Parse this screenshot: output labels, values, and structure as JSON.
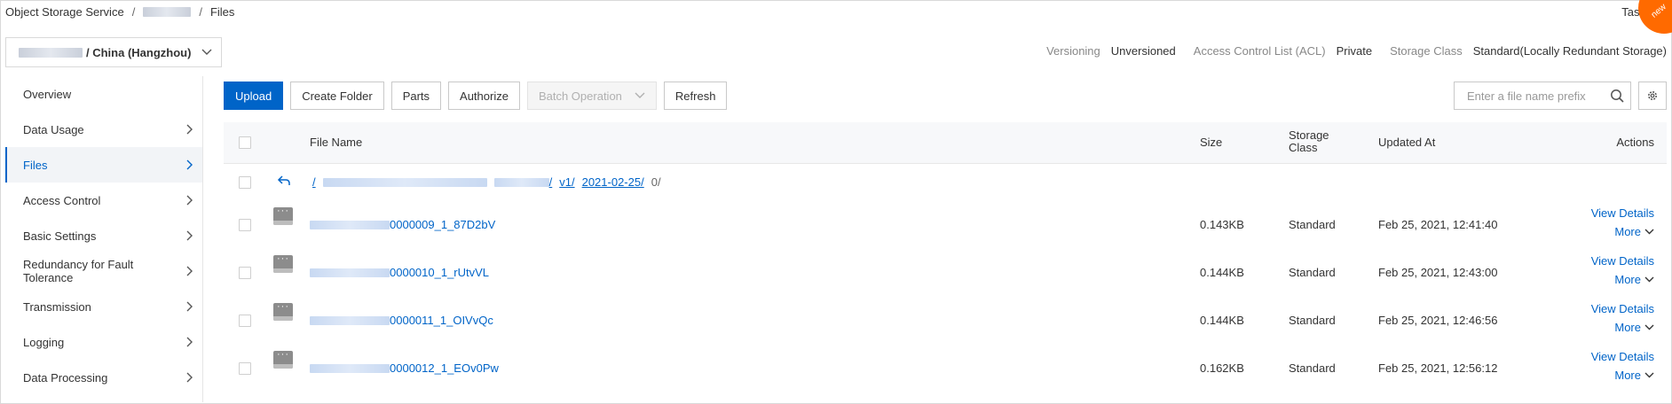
{
  "breadcrumb": {
    "service": "Object Storage Service",
    "sep": "/",
    "current": "Files"
  },
  "header": {
    "tasks_label": "Task",
    "badge_text": "new"
  },
  "region": {
    "value": "/ China (Hangzhou)"
  },
  "bucket_meta": {
    "versioning_label": "Versioning",
    "versioning_value": "Unversioned",
    "acl_label": "Access Control List (ACL)",
    "acl_value": "Private",
    "storage_label": "Storage Class",
    "storage_value": "Standard(Locally Redundant Storage)"
  },
  "sidebar": {
    "items": [
      {
        "label": "Overview",
        "chevron": false,
        "active": false
      },
      {
        "label": "Data Usage",
        "chevron": true,
        "active": false
      },
      {
        "label": "Files",
        "chevron": true,
        "active": true
      },
      {
        "label": "Access Control",
        "chevron": true,
        "active": false
      },
      {
        "label": "Basic Settings",
        "chevron": true,
        "active": false
      },
      {
        "label": "Redundancy for Fault Tolerance",
        "chevron": true,
        "active": false
      },
      {
        "label": "Transmission",
        "chevron": true,
        "active": false
      },
      {
        "label": "Logging",
        "chevron": true,
        "active": false
      },
      {
        "label": "Data Processing",
        "chevron": true,
        "active": false
      }
    ]
  },
  "toolbar": {
    "upload": "Upload",
    "create_folder": "Create Folder",
    "parts": "Parts",
    "authorize": "Authorize",
    "batch_operation": "Batch Operation",
    "refresh": "Refresh"
  },
  "search": {
    "placeholder": "Enter a file name prefix",
    "value": ""
  },
  "table": {
    "headers": {
      "file_name": "File Name",
      "size": "Size",
      "storage_class_line1": "Storage",
      "storage_class_line2": "Class",
      "updated_at": "Updated At",
      "actions": "Actions"
    },
    "path": {
      "root": "/",
      "v1": "v1/",
      "date": "2021-02-25/",
      "last": "0/"
    },
    "rows": [
      {
        "name_suffix": "0000009_1_87D2bV",
        "size": "0.143KB",
        "storage_class": "Standard",
        "updated": "Feb 25, 2021, 12:41:40",
        "view": "View Details",
        "more": "More"
      },
      {
        "name_suffix": "0000010_1_rUtvVL",
        "size": "0.144KB",
        "storage_class": "Standard",
        "updated": "Feb 25, 2021, 12:43:00",
        "view": "View Details",
        "more": "More"
      },
      {
        "name_suffix": "0000011_1_OIVvQc",
        "size": "0.144KB",
        "storage_class": "Standard",
        "updated": "Feb 25, 2021, 12:46:56",
        "view": "View Details",
        "more": "More"
      },
      {
        "name_suffix": "0000012_1_EOv0Pw",
        "size": "0.162KB",
        "storage_class": "Standard",
        "updated": "Feb 25, 2021, 12:56:12",
        "view": "View Details",
        "more": "More"
      }
    ]
  },
  "colors": {
    "primary": "#0064c8",
    "accent_orange": "#ff6a00"
  },
  "icons": {
    "chevron": "chevron-right-icon",
    "back": "back-arrow-icon",
    "file": "file-icon",
    "search": "search-icon",
    "settings": "gear-icon"
  }
}
